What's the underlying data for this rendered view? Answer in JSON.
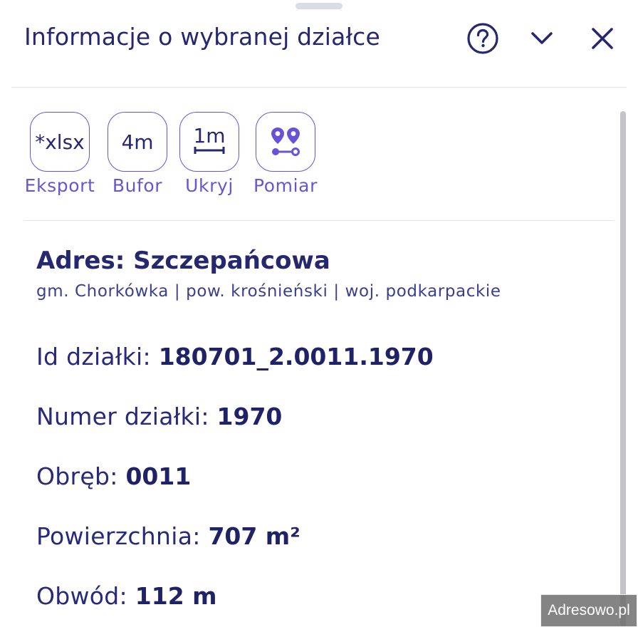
{
  "header": {
    "title": "Informacje o wybranej działce",
    "icons": [
      "help-circle-icon",
      "chevron-down-icon",
      "close-icon"
    ]
  },
  "tools": [
    {
      "label": "Eksport",
      "icon_text": "*xlsx",
      "icon": "xlsx-export-icon"
    },
    {
      "label": "Bufor",
      "icon_text": "4m",
      "icon": "buffer-icon"
    },
    {
      "label": "Ukryj",
      "icon_text": "1m",
      "icon": "hide-dimensions-icon"
    },
    {
      "label": "Pomiar",
      "icon": "measure-pins-icon"
    }
  ],
  "parcel": {
    "address": "Adres: Szczepańcowa",
    "location": "gm. Chorkówka | pow. krośnieński | woj. podkarpackie",
    "id_label": "Id działki: ",
    "id_value": "180701_2.0011.1970",
    "number_label": "Numer działki: ",
    "number_value": "1970",
    "precinct_label": "Obręb: ",
    "precinct_value": "0011",
    "area_label": "Powierzchnia: ",
    "area_value": "707 m²",
    "perimeter_label": "Obwód: ",
    "perimeter_value": "112 m"
  },
  "watermark": "Adresowo.pl",
  "colors": {
    "text_primary": "#25286f",
    "accent": "#6a52d6",
    "tool_label": "#6558cf"
  }
}
